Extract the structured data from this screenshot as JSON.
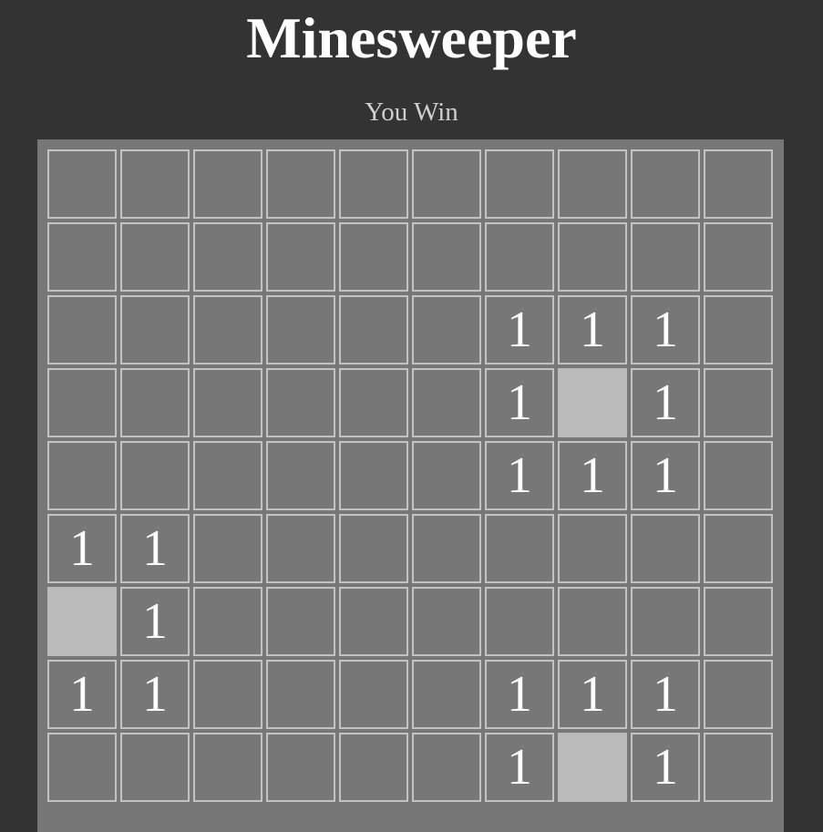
{
  "header": {
    "title": "Minesweeper",
    "status": "You Win"
  },
  "colors": {
    "page_background": "#333333",
    "board_background": "#777777",
    "cell_border": "#c4c4c4",
    "revealed_mine": "#bbbbbb",
    "number_text": "#ffffff"
  },
  "board": {
    "visible_rows": [
      [
        "",
        "",
        "",
        "",
        "",
        "",
        "",
        "",
        "",
        ""
      ],
      [
        "",
        "",
        "",
        "",
        "",
        "",
        "",
        "",
        "",
        ""
      ],
      [
        "",
        "",
        "",
        "",
        "",
        "",
        "1",
        "1",
        "1",
        ""
      ],
      [
        "",
        "",
        "",
        "",
        "",
        "",
        "1",
        "M",
        "1",
        ""
      ],
      [
        "",
        "",
        "",
        "",
        "",
        "",
        "1",
        "1",
        "1",
        ""
      ],
      [
        "1",
        "1",
        "",
        "",
        "",
        "",
        "",
        "",
        "",
        ""
      ],
      [
        "M",
        "1",
        "",
        "",
        "",
        "",
        "",
        "",
        "",
        ""
      ],
      [
        "1",
        "1",
        "",
        "",
        "",
        "",
        "1",
        "1",
        "1",
        ""
      ],
      [
        "",
        "",
        "",
        "",
        "",
        "",
        "1",
        "M",
        "1",
        ""
      ]
    ]
  }
}
